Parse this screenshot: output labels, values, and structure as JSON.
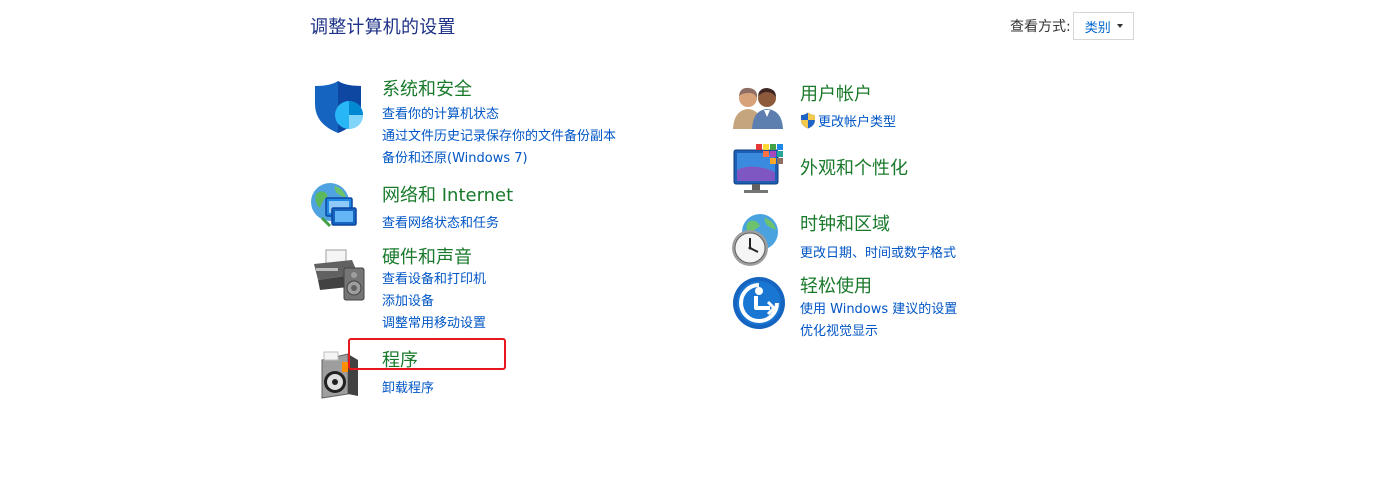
{
  "header": {
    "title": "调整计算机的设置",
    "view_by_label": "查看方式:",
    "view_by_value": "类别"
  },
  "categories_left": [
    {
      "title": "系统和安全",
      "links": [
        "查看你的计算机状态",
        "通过文件历史记录保存你的文件备份副本",
        "备份和还原(Windows 7)"
      ],
      "icon": "shield-icon"
    },
    {
      "title": "网络和 Internet",
      "links": [
        "查看网络状态和任务"
      ],
      "icon": "network-globe-icon"
    },
    {
      "title": "硬件和声音",
      "links": [
        "查看设备和打印机",
        "添加设备",
        "调整常用移动设置"
      ],
      "icon": "printer-icon"
    },
    {
      "title": "程序",
      "links": [
        "卸载程序"
      ],
      "icon": "programs-disc-icon"
    }
  ],
  "categories_right": [
    {
      "title": "用户帐户",
      "links": [
        "更改帐户类型"
      ],
      "icon": "users-icon"
    },
    {
      "title": "外观和个性化",
      "links": [],
      "icon": "monitor-palette-icon"
    },
    {
      "title": "时钟和区域",
      "links": [
        "更改日期、时间或数字格式"
      ],
      "icon": "clock-globe-icon"
    },
    {
      "title": "轻松使用",
      "links": [
        "使用 Windows 建议的设置",
        "优化视觉显示"
      ],
      "icon": "ease-of-access-icon"
    }
  ],
  "colors": {
    "title": "#1e3287",
    "category_green": "#1a7a2b",
    "link_blue": "#0056c6",
    "highlight_red": "#e8171e"
  }
}
